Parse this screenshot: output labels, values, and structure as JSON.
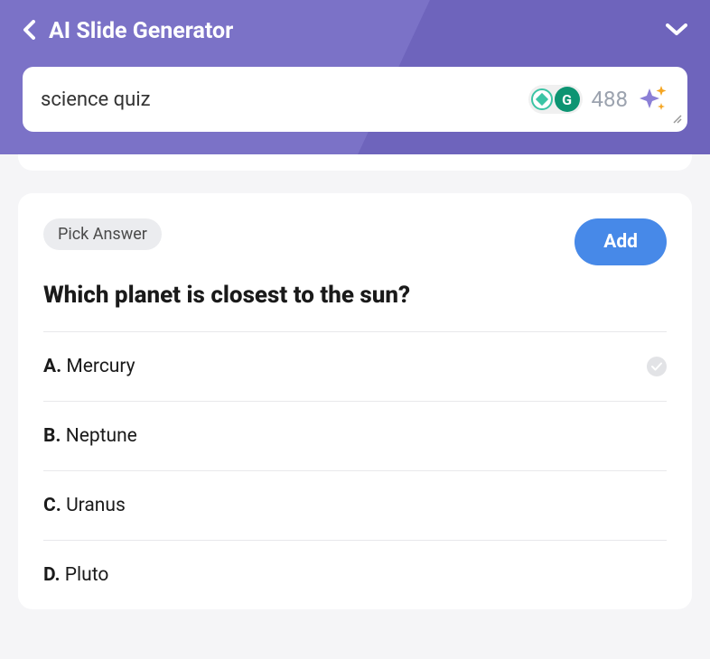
{
  "header": {
    "title": "AI Slide Generator",
    "search_value": "science quiz",
    "counter": "488"
  },
  "quiz": {
    "badge_label": "Pick Answer",
    "add_button": "Add",
    "question": "Which planet is closest to the sun?",
    "options": [
      {
        "letter": "A.",
        "text": "Mercury",
        "correct": true
      },
      {
        "letter": "B.",
        "text": "Neptune",
        "correct": false
      },
      {
        "letter": "C.",
        "text": "Uranus",
        "correct": false
      },
      {
        "letter": "D.",
        "text": "Pluto",
        "correct": false
      }
    ]
  }
}
